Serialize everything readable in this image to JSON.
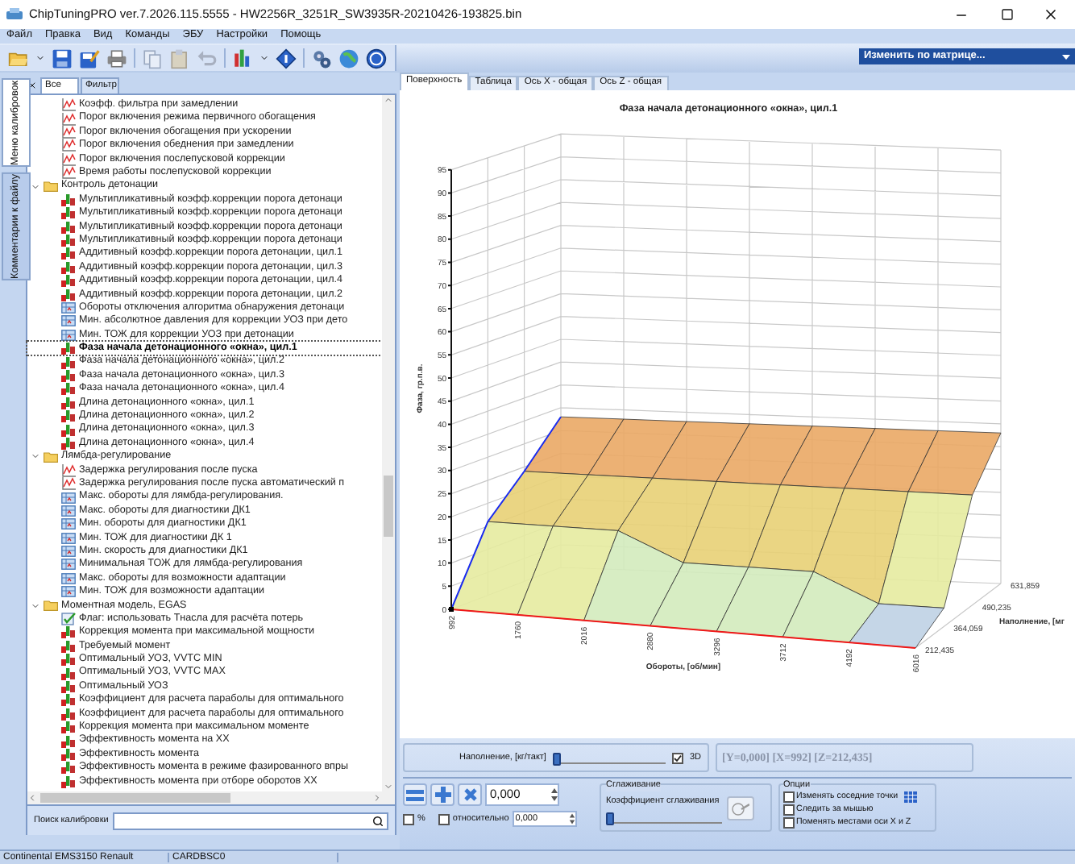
{
  "window": {
    "title": "ChipTuningPRO ver.7.2026.115.5555 - HW2256R_3251R_SW3935R-20210426-193825.bin"
  },
  "menu": [
    "Файл",
    "Правка",
    "Вид",
    "Команды",
    "ЭБУ",
    "Настройки",
    "Помощь"
  ],
  "toolbar": {
    "matrix_dropdown": "Изменить по матрице..."
  },
  "side_tabs": [
    {
      "label": "Меню калибровок",
      "selected": true
    },
    {
      "label": "Комментарии к файлу",
      "selected": false
    }
  ],
  "filter_tabs": [
    {
      "label": "Все",
      "selected": true
    },
    {
      "label": "Фильтр",
      "selected": false
    }
  ],
  "tree": [
    {
      "label": "Коэфф. фильтра при замедлении",
      "kind": "curve",
      "selected": false
    },
    {
      "label": "Порог включения режима первичного обогащения",
      "kind": "curve",
      "selected": false
    },
    {
      "label": "Порог включения обогащения при ускорении",
      "kind": "curve",
      "selected": false
    },
    {
      "label": "Порог включения обеднения при замедлении",
      "kind": "curve",
      "selected": false
    },
    {
      "label": "Порог включения послепусковой коррекции",
      "kind": "curve",
      "selected": false
    },
    {
      "label": "Время работы послепусковой коррекции",
      "kind": "curve",
      "selected": false
    },
    {
      "label": "Контроль детонации",
      "kind": "folder",
      "expanded": true,
      "selected": false,
      "children": [
        {
          "label": "Мультипликативный коэфф.коррекции порога детонаци",
          "kind": "map",
          "selected": false
        },
        {
          "label": "Мультипликативный коэфф.коррекции порога детонаци",
          "kind": "map",
          "selected": false
        },
        {
          "label": "Мультипликативный коэфф.коррекции порога детонаци",
          "kind": "map",
          "selected": false
        },
        {
          "label": "Мультипликативный коэфф.коррекции порога детонаци",
          "kind": "map",
          "selected": false
        },
        {
          "label": "Аддитивный коэфф.коррекции порога детонации, цил.1",
          "kind": "map",
          "selected": false
        },
        {
          "label": "Аддитивный коэфф.коррекции порога детонации, цил.3",
          "kind": "map",
          "selected": false
        },
        {
          "label": "Аддитивный коэфф.коррекции порога детонации, цил.4",
          "kind": "map",
          "selected": false
        },
        {
          "label": "Аддитивный коэфф.коррекции порога детонации, цил.2",
          "kind": "map",
          "selected": false
        },
        {
          "label": "Обороты отключения алгоритма обнаружения детонаци",
          "kind": "table",
          "selected": false
        },
        {
          "label": "Мин. абсолютное давления для коррекции УОЗ при дето",
          "kind": "table",
          "selected": false
        },
        {
          "label": "Мин. ТОЖ для коррекции УОЗ при детонации",
          "kind": "table",
          "selected": false
        },
        {
          "label": "Фаза начала детонационного «окна», цил.1",
          "kind": "map",
          "selected": true
        },
        {
          "label": "Фаза начала детонационного «окна», цил.2",
          "kind": "map",
          "selected": false
        },
        {
          "label": "Фаза начала детонационного «окна», цил.3",
          "kind": "map",
          "selected": false
        },
        {
          "label": "Фаза начала детонационного «окна», цил.4",
          "kind": "map",
          "selected": false
        },
        {
          "label": "Длина детонационного «окна», цил.1",
          "kind": "map",
          "selected": false
        },
        {
          "label": "Длина детонационного «окна», цил.2",
          "kind": "map",
          "selected": false
        },
        {
          "label": "Длина детонационного «окна», цил.3",
          "kind": "map",
          "selected": false
        },
        {
          "label": "Длина детонационного «окна», цил.4",
          "kind": "map",
          "selected": false
        }
      ]
    },
    {
      "label": "Лямбда-регулирование",
      "kind": "folder",
      "expanded": true,
      "selected": false,
      "children": [
        {
          "label": "Задержка регулирования после пуска",
          "kind": "curve",
          "selected": false
        },
        {
          "label": "Задержка регулирования после пуска автоматический п",
          "kind": "curve",
          "selected": false
        },
        {
          "label": "Макс. обороты для лямбда-регулирования.",
          "kind": "table",
          "selected": false
        },
        {
          "label": "Макс. обороты для диагностики ДК1",
          "kind": "table",
          "selected": false
        },
        {
          "label": "Мин. обороты для диагностики ДК1",
          "kind": "table",
          "selected": false
        },
        {
          "label": "Мин. ТОЖ для диагностики ДК 1",
          "kind": "table",
          "selected": false
        },
        {
          "label": "Мин. скорость для диагностики ДК1",
          "kind": "table",
          "selected": false
        },
        {
          "label": "Минимальная ТОЖ для лямбда-регулирования",
          "kind": "table",
          "selected": false
        },
        {
          "label": "Макс. обороты для возможности адаптации",
          "kind": "table",
          "selected": false
        },
        {
          "label": "Мин. ТОЖ для возможности адаптации",
          "kind": "table",
          "selected": false
        }
      ]
    },
    {
      "label": "Моментная модель, EGAS",
      "kind": "folder",
      "expanded": true,
      "selected": false,
      "children": [
        {
          "label": "Флаг: использовать Тнасла для расчёта потерь",
          "kind": "flag",
          "selected": false
        },
        {
          "label": "Коррекция момента при максимальной мощности",
          "kind": "map",
          "selected": false
        },
        {
          "label": "Требуемый момент",
          "kind": "map",
          "selected": false
        },
        {
          "label": "Оптимальный УОЗ, VVTC MIN",
          "kind": "map",
          "selected": false
        },
        {
          "label": "Оптимальный УОЗ, VVTC MAX",
          "kind": "map",
          "selected": false
        },
        {
          "label": "Оптимальный УОЗ",
          "kind": "map",
          "selected": false
        },
        {
          "label": "Коэффициент для расчета параболы для оптимального",
          "kind": "map",
          "selected": false
        },
        {
          "label": "Коэффициент для расчета параболы для оптимального",
          "kind": "map",
          "selected": false
        },
        {
          "label": "Коррекция момента при максимальном моменте",
          "kind": "map",
          "selected": false
        },
        {
          "label": "Эффективность момента на ХХ",
          "kind": "map",
          "selected": false
        },
        {
          "label": "Эффективность момента",
          "kind": "map",
          "selected": false
        },
        {
          "label": "Эффективность момента в режиме фазированного впры",
          "kind": "map",
          "selected": false
        },
        {
          "label": "Эффективность момента при отборе оборотов ХХ",
          "kind": "map",
          "selected": false
        }
      ]
    }
  ],
  "search": {
    "label": "Поиск калибровки"
  },
  "view_tabs": [
    {
      "label": "Поверхность",
      "selected": true
    },
    {
      "label": "Таблица",
      "selected": false
    },
    {
      "label": "Ось X - общая",
      "selected": false
    },
    {
      "label": "Ось Z - общая",
      "selected": false
    }
  ],
  "chart": {
    "title": "Фаза начала детонационного «окна», цил.1",
    "y_label": "Фаза, гр.п.в.",
    "y_ticks": [
      "95",
      "90",
      "85",
      "80",
      "75",
      "70",
      "65",
      "60",
      "55",
      "50",
      "45",
      "40",
      "35",
      "30",
      "25",
      "20",
      "15",
      "10",
      "5",
      "0"
    ],
    "x_label": "Обороты, [об/мин]",
    "x_ticks": [
      "992",
      "1760",
      "2016",
      "2880",
      "3296",
      "3712",
      "4192",
      "6016"
    ],
    "z_label": "Наполнение, [мг",
    "z_ticks": [
      "631,859",
      "490,235",
      "364,059",
      "212,435"
    ]
  },
  "fill_slider": {
    "label": "Наполнение, [кг/такт]",
    "level": 0
  },
  "view_3d": {
    "label": "3D",
    "checked": true
  },
  "readout": "[Y=0,000] [X=992] [Z=212,435]",
  "value_field": {
    "value": "0,000"
  },
  "percent": {
    "label": "%",
    "checked": false
  },
  "relative": {
    "label": "относительно",
    "checked": false,
    "value": "0,000"
  },
  "smoothing": {
    "title": "Сглаживание",
    "label": "Коэффициент сглаживания",
    "level": 0
  },
  "options": {
    "title": "Опции",
    "items": [
      {
        "label": "Изменять соседние точки",
        "checked": false
      },
      {
        "label": "Следить за мышью",
        "checked": false
      },
      {
        "label": "Поменять местами оси X и Z",
        "checked": false
      }
    ]
  },
  "status_bar": [
    "Continental EMS3150 Renault",
    "CARDBSC0"
  ]
}
